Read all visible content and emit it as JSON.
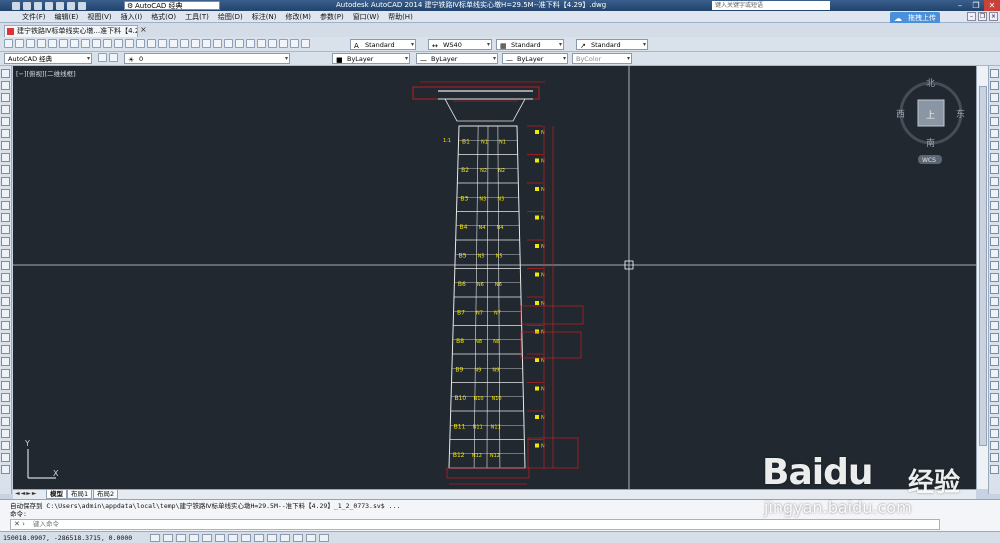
{
  "titlebar": {
    "workspace": "AutoCAD 经典",
    "app_title": "Autodesk AutoCAD 2014    建宁铁路Ⅳ标单线实心墩H=29.5M--准下料【4.29】.dwg",
    "search_placeholder": "键入关键字或短语",
    "minimize": "–",
    "restore": "❐",
    "close": "✕"
  },
  "menu": {
    "items": [
      "文件(F)",
      "编辑(E)",
      "视图(V)",
      "插入(I)",
      "格式(O)",
      "工具(T)",
      "绘图(D)",
      "标注(N)",
      "修改(M)",
      "参数(P)",
      "窗口(W)",
      "帮助(H)"
    ],
    "upload_label": "拖拽上传"
  },
  "doc_tab": {
    "label": "建宁铁路Ⅳ标单线实心墩...准下料【4.29】*",
    "close": "×"
  },
  "toolbar1": {
    "text_style": "Standard",
    "dim_style": "WS40",
    "table_style": "Standard",
    "mleader_style": "Standard"
  },
  "toolbar2": {
    "workspace": "AutoCAD 经典",
    "layer": "0",
    "color": "ByLayer",
    "linetype": "ByLayer",
    "lineweight": "ByLayer",
    "plotstyle": "ByColor"
  },
  "canvas": {
    "viewport_label": "[−][俯视][二维线框]",
    "viewcube": {
      "north": "北",
      "south": "南",
      "west": "西",
      "east": "东",
      "top": "上",
      "wcs": "WCS"
    },
    "ucs": {
      "x": "X",
      "y": "Y"
    },
    "segment_labels": [
      "B1",
      "B2",
      "B3",
      "B4",
      "B5",
      "B6",
      "B7",
      "B8",
      "B9",
      "B10",
      "B11",
      "B12"
    ]
  },
  "layout_tabs": {
    "nav": "◄◄►►",
    "tabs": [
      "模型",
      "布局1",
      "布局2"
    ]
  },
  "command": {
    "history_1": "自动保存到 C:\\Users\\admin\\appdata\\local\\temp\\建宁铁路Ⅳ标单线实心墩H=29.5M--准下料【4.29】_1_2_0773.sv$ ...",
    "history_2": "命令:",
    "input_placeholder": "键入命令"
  },
  "status": {
    "coords": "150018.0907, -286518.3715, 0.0000"
  },
  "watermark": {
    "brand": "Baidu",
    "product": "经验",
    "url": "jingyan.baidu.com"
  },
  "colors": {
    "canvas_bg": "#212830",
    "drawing_line": "#e8e8e8",
    "dimension": "#e21c1c",
    "label_text": "#f2e700"
  }
}
